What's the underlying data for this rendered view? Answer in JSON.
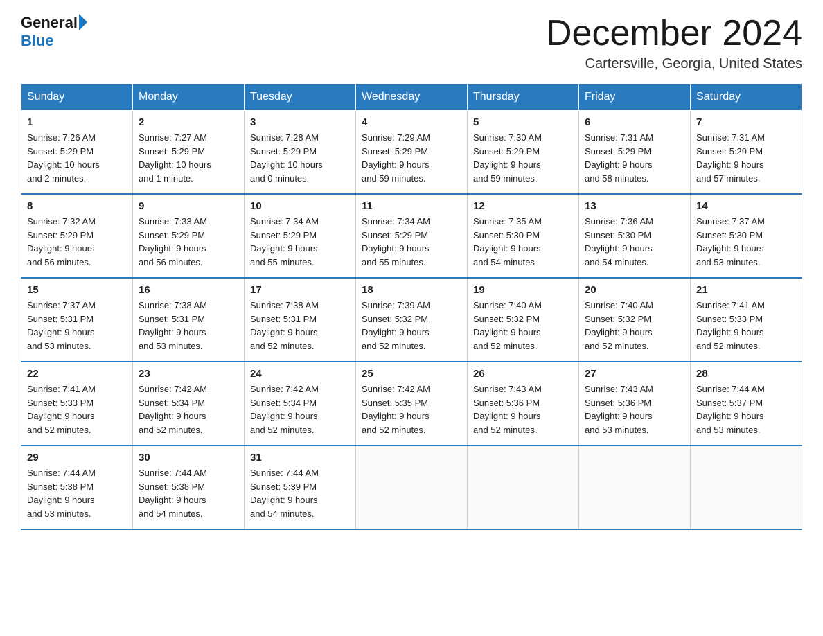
{
  "header": {
    "logo_general": "General",
    "logo_blue": "Blue",
    "month_title": "December 2024",
    "location": "Cartersville, Georgia, United States"
  },
  "days_of_week": [
    "Sunday",
    "Monday",
    "Tuesday",
    "Wednesday",
    "Thursday",
    "Friday",
    "Saturday"
  ],
  "weeks": [
    [
      {
        "day": "1",
        "sunrise": "7:26 AM",
        "sunset": "5:29 PM",
        "daylight": "10 hours and 2 minutes."
      },
      {
        "day": "2",
        "sunrise": "7:27 AM",
        "sunset": "5:29 PM",
        "daylight": "10 hours and 1 minute."
      },
      {
        "day": "3",
        "sunrise": "7:28 AM",
        "sunset": "5:29 PM",
        "daylight": "10 hours and 0 minutes."
      },
      {
        "day": "4",
        "sunrise": "7:29 AM",
        "sunset": "5:29 PM",
        "daylight": "9 hours and 59 minutes."
      },
      {
        "day": "5",
        "sunrise": "7:30 AM",
        "sunset": "5:29 PM",
        "daylight": "9 hours and 59 minutes."
      },
      {
        "day": "6",
        "sunrise": "7:31 AM",
        "sunset": "5:29 PM",
        "daylight": "9 hours and 58 minutes."
      },
      {
        "day": "7",
        "sunrise": "7:31 AM",
        "sunset": "5:29 PM",
        "daylight": "9 hours and 57 minutes."
      }
    ],
    [
      {
        "day": "8",
        "sunrise": "7:32 AM",
        "sunset": "5:29 PM",
        "daylight": "9 hours and 56 minutes."
      },
      {
        "day": "9",
        "sunrise": "7:33 AM",
        "sunset": "5:29 PM",
        "daylight": "9 hours and 56 minutes."
      },
      {
        "day": "10",
        "sunrise": "7:34 AM",
        "sunset": "5:29 PM",
        "daylight": "9 hours and 55 minutes."
      },
      {
        "day": "11",
        "sunrise": "7:34 AM",
        "sunset": "5:29 PM",
        "daylight": "9 hours and 55 minutes."
      },
      {
        "day": "12",
        "sunrise": "7:35 AM",
        "sunset": "5:30 PM",
        "daylight": "9 hours and 54 minutes."
      },
      {
        "day": "13",
        "sunrise": "7:36 AM",
        "sunset": "5:30 PM",
        "daylight": "9 hours and 54 minutes."
      },
      {
        "day": "14",
        "sunrise": "7:37 AM",
        "sunset": "5:30 PM",
        "daylight": "9 hours and 53 minutes."
      }
    ],
    [
      {
        "day": "15",
        "sunrise": "7:37 AM",
        "sunset": "5:31 PM",
        "daylight": "9 hours and 53 minutes."
      },
      {
        "day": "16",
        "sunrise": "7:38 AM",
        "sunset": "5:31 PM",
        "daylight": "9 hours and 53 minutes."
      },
      {
        "day": "17",
        "sunrise": "7:38 AM",
        "sunset": "5:31 PM",
        "daylight": "9 hours and 52 minutes."
      },
      {
        "day": "18",
        "sunrise": "7:39 AM",
        "sunset": "5:32 PM",
        "daylight": "9 hours and 52 minutes."
      },
      {
        "day": "19",
        "sunrise": "7:40 AM",
        "sunset": "5:32 PM",
        "daylight": "9 hours and 52 minutes."
      },
      {
        "day": "20",
        "sunrise": "7:40 AM",
        "sunset": "5:32 PM",
        "daylight": "9 hours and 52 minutes."
      },
      {
        "day": "21",
        "sunrise": "7:41 AM",
        "sunset": "5:33 PM",
        "daylight": "9 hours and 52 minutes."
      }
    ],
    [
      {
        "day": "22",
        "sunrise": "7:41 AM",
        "sunset": "5:33 PM",
        "daylight": "9 hours and 52 minutes."
      },
      {
        "day": "23",
        "sunrise": "7:42 AM",
        "sunset": "5:34 PM",
        "daylight": "9 hours and 52 minutes."
      },
      {
        "day": "24",
        "sunrise": "7:42 AM",
        "sunset": "5:34 PM",
        "daylight": "9 hours and 52 minutes."
      },
      {
        "day": "25",
        "sunrise": "7:42 AM",
        "sunset": "5:35 PM",
        "daylight": "9 hours and 52 minutes."
      },
      {
        "day": "26",
        "sunrise": "7:43 AM",
        "sunset": "5:36 PM",
        "daylight": "9 hours and 52 minutes."
      },
      {
        "day": "27",
        "sunrise": "7:43 AM",
        "sunset": "5:36 PM",
        "daylight": "9 hours and 53 minutes."
      },
      {
        "day": "28",
        "sunrise": "7:44 AM",
        "sunset": "5:37 PM",
        "daylight": "9 hours and 53 minutes."
      }
    ],
    [
      {
        "day": "29",
        "sunrise": "7:44 AM",
        "sunset": "5:38 PM",
        "daylight": "9 hours and 53 minutes."
      },
      {
        "day": "30",
        "sunrise": "7:44 AM",
        "sunset": "5:38 PM",
        "daylight": "9 hours and 54 minutes."
      },
      {
        "day": "31",
        "sunrise": "7:44 AM",
        "sunset": "5:39 PM",
        "daylight": "9 hours and 54 minutes."
      },
      null,
      null,
      null,
      null
    ]
  ],
  "labels": {
    "sunrise": "Sunrise:",
    "sunset": "Sunset:",
    "daylight": "Daylight:"
  },
  "colors": {
    "header_bg": "#2a7abf",
    "accent_blue": "#1a75bc"
  }
}
